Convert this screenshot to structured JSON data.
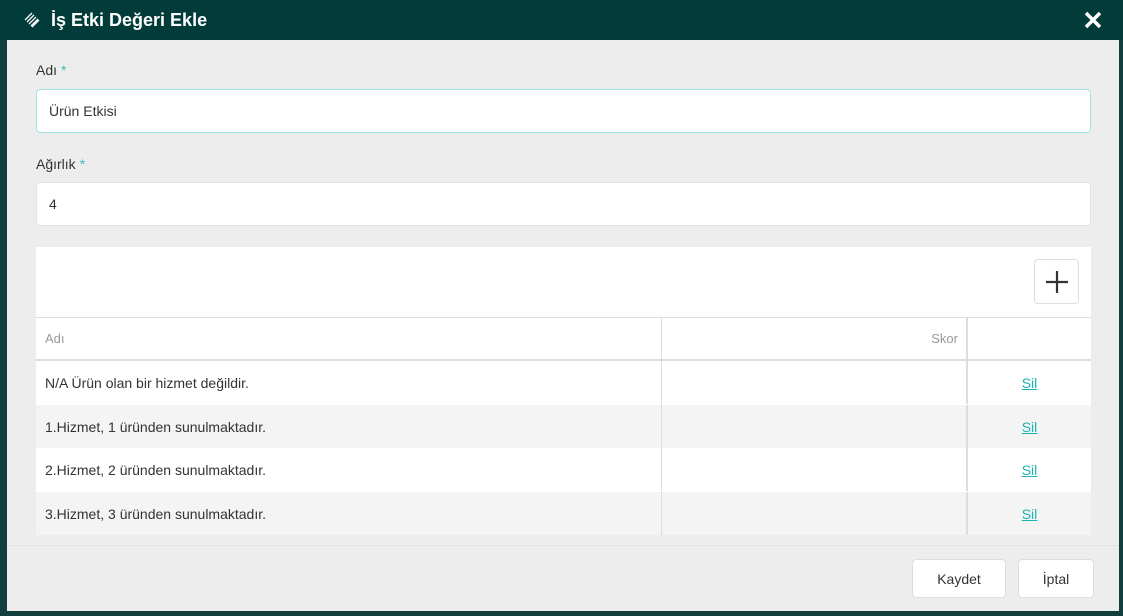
{
  "dialog": {
    "title": "İş Etki Değeri Ekle"
  },
  "form": {
    "name_label": "Adı",
    "name_value": "Ürün Etkisi",
    "weight_label": "Ağırlık",
    "weight_value": "4",
    "required_mark": "*"
  },
  "table": {
    "headers": [
      "Adı",
      "Skor",
      ""
    ],
    "rows": [
      {
        "name": "N/A Ürün olan bir hizmet değildir.",
        "score": "",
        "action": "Sil"
      },
      {
        "name": "1.Hizmet, 1 üründen sunulmaktadır.",
        "score": "",
        "action": "Sil"
      },
      {
        "name": "2.Hizmet, 2 üründen sunulmaktadır.",
        "score": "",
        "action": "Sil"
      },
      {
        "name": "3.Hizmet, 3 üründen sunulmaktadır.",
        "score": "",
        "action": "Sil"
      }
    ]
  },
  "footer": {
    "save_label": "Kaydet",
    "cancel_label": "İptal"
  }
}
